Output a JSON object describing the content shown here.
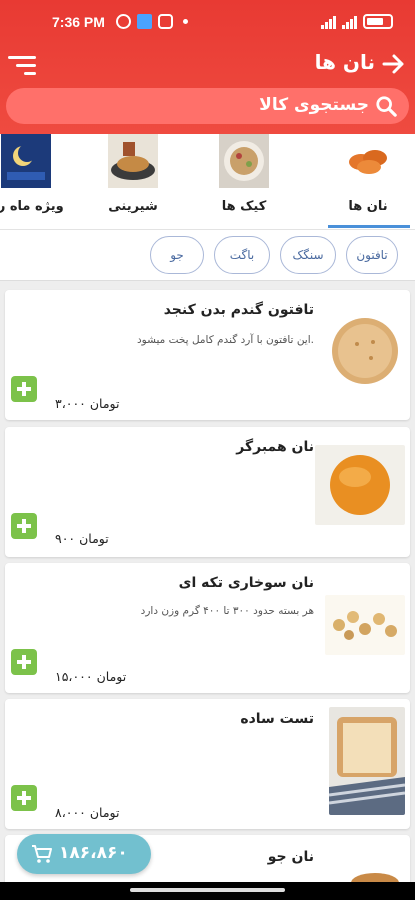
{
  "status_bar": {
    "time": "7:36 PM"
  },
  "header": {
    "title": "نان ها"
  },
  "search": {
    "placeholder": "جستجوی کالا"
  },
  "categories": [
    {
      "label": "نان ها",
      "active": true
    },
    {
      "label": "کیک ها",
      "active": false
    },
    {
      "label": "شیرینی",
      "active": false
    },
    {
      "label": "ویژه ماه رم",
      "active": false
    }
  ],
  "chips": [
    "تافتون",
    "سنگک",
    "باگت",
    "جو"
  ],
  "products": [
    {
      "name": "تافتون گندم بدن کنجد",
      "description": "این تافتون با آرد گندم کامل پخت میشود.",
      "price": "۳،۰۰۰ تومان"
    },
    {
      "name": "نان همبرگر",
      "description": "",
      "price": "۹۰۰ تومان"
    },
    {
      "name": "نان سوخاری تکه ای",
      "description": "هر بسته حدود ۳۰۰ تا ۴۰۰ گرم وزن دارد",
      "price": "۱۵،۰۰۰ تومان"
    },
    {
      "name": "تست ساده",
      "description": "",
      "price": "۸،۰۰۰ تومان"
    },
    {
      "name": "نان جو",
      "description": "",
      "price": ""
    }
  ],
  "cart": {
    "total": "۱۸۶،۸۶۰"
  },
  "colors": {
    "header": "#e83a33",
    "accent": "#4a90d9",
    "add_button": "#7cc24a",
    "cart": "#72c0cf"
  }
}
